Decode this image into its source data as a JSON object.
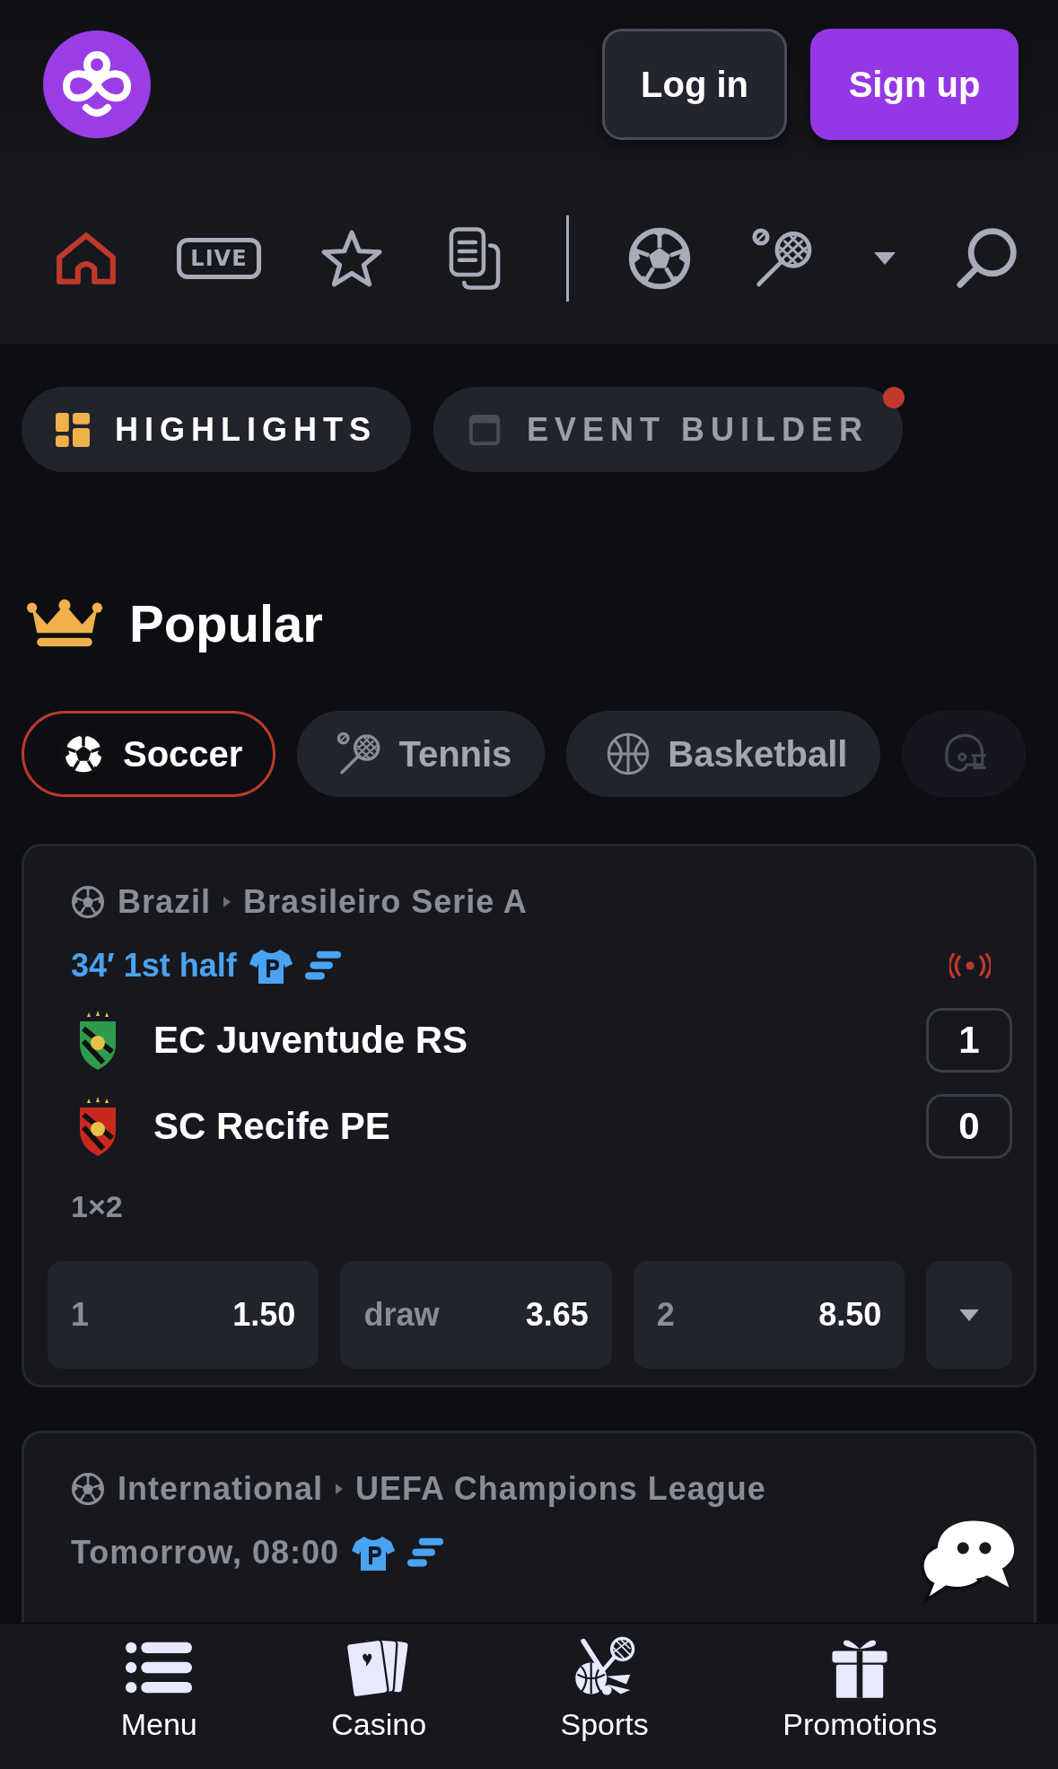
{
  "header": {
    "buttons": [
      {
        "label": "Log in",
        "kind": "secondary"
      },
      {
        "label": "Sign up",
        "kind": "primary"
      }
    ]
  },
  "nav": [
    {
      "kind": "home",
      "selected": true
    },
    {
      "kind": "live",
      "label": "LIVE",
      "selected": false
    },
    {
      "kind": "favorites",
      "selected": false
    },
    {
      "kind": "betslip",
      "selected": false
    },
    {
      "kind": "divider"
    },
    {
      "kind": "soccer",
      "selected": false
    },
    {
      "kind": "tennis",
      "selected": false
    },
    {
      "kind": "more",
      "selected": false
    },
    {
      "kind": "search",
      "selected": false
    }
  ],
  "sections": [
    {
      "label": "HIGHLIGHTS",
      "kind": "highlights",
      "selected": true,
      "notification": false
    },
    {
      "label": "EVENT BUILDER",
      "kind": "builder",
      "selected": false,
      "notification": true
    }
  ],
  "popular": {
    "title": "Popular",
    "sports": [
      {
        "label": "Soccer",
        "kind": "soccer",
        "selected": true
      },
      {
        "label": "Tennis",
        "kind": "tennis",
        "selected": false
      },
      {
        "label": "Basketball",
        "kind": "basketball",
        "selected": false
      },
      {
        "kind": "football",
        "selected": false
      }
    ]
  },
  "matches": [
    {
      "country": "Brazil",
      "league": "Brasileiro Serie A",
      "status": "34′ 1st half",
      "live": true,
      "teams": [
        {
          "name": "EC Juventude RS",
          "score": "1",
          "color": "#2e9a4c"
        },
        {
          "name": "SC Recife PE",
          "score": "0",
          "color": "#c8281e"
        }
      ],
      "market": {
        "title": "1×2",
        "odds": [
          {
            "label": "1",
            "price": "1.50"
          },
          {
            "label": "draw",
            "price": "3.65"
          },
          {
            "label": "2",
            "price": "8.50"
          }
        ]
      }
    },
    {
      "country": "International",
      "league": "UEFA Champions League",
      "status": "Tomorrow, 08:00",
      "live": false
    }
  ],
  "bottom_nav": [
    {
      "label": "Menu",
      "kind": "menu"
    },
    {
      "label": "Casino",
      "kind": "casino"
    },
    {
      "label": "Sports",
      "kind": "sports"
    },
    {
      "label": "Promotions",
      "kind": "promotions"
    }
  ]
}
